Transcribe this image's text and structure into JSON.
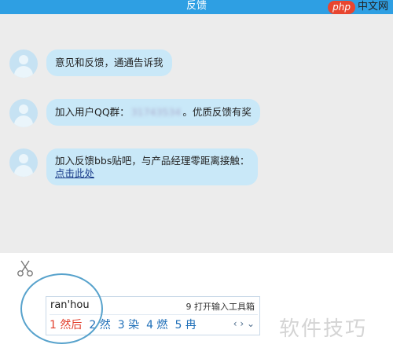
{
  "title": "反馈",
  "watermark": {
    "logo": "php",
    "text": "中文网"
  },
  "messages": [
    {
      "text": "意见和反馈，通通告诉我"
    },
    {
      "prefix": "加入用户QQ群：",
      "blurred": "31743534",
      "suffix": "。优质反馈有奖"
    },
    {
      "line1": "加入反馈bbs贴吧，与产品经理零距离接触：",
      "link": "点击此处"
    }
  ],
  "ime": {
    "pinyin": "ran'hou",
    "tools_label": "9 打开输入工具箱",
    "candidates": [
      "1 然后",
      "2 然",
      "3 染",
      "4 燃",
      "5 冉"
    ],
    "pager": "‹ › ⌄"
  },
  "watermark_bottom": "软件技巧",
  "colors": {
    "titlebar": "#2e9fe3",
    "bubble": "#c9e8f8",
    "first_candidate": "#e13d2b",
    "candidate": "#1f6fb8",
    "circle": "#57a2cc"
  },
  "icons": [
    "avatar-icon",
    "scissors-icon"
  ]
}
